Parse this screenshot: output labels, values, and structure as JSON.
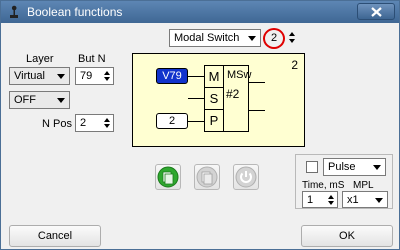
{
  "window": {
    "title": "Boolean functions"
  },
  "top": {
    "mode_select": "Modal Switch",
    "number_value": "2"
  },
  "left": {
    "layer_label": "Layer",
    "but_n_label": "But N",
    "layer_select": "Virtual",
    "but_n_value": "79",
    "state_select": "OFF",
    "n_pos_label": "N Pos",
    "n_pos_value": "2"
  },
  "block": {
    "index": "2",
    "input_tag": "V79",
    "pins": [
      "M",
      "S",
      "P"
    ],
    "type": "MSw",
    "number": "#2",
    "p_value": "2"
  },
  "right": {
    "pulse_select": "Pulse",
    "time_label": "Time, mS",
    "mpl_label": "MPL",
    "time_value": "1",
    "mpl_select": "x1"
  },
  "buttons": {
    "cancel": "Cancel",
    "ok": "OK"
  },
  "colors": {
    "titlebar": "#4a739f",
    "block_bg": "#ffffd2",
    "tag_bg": "#1133cc",
    "highlight": "#e00000",
    "play_green": "#2fa82f"
  }
}
